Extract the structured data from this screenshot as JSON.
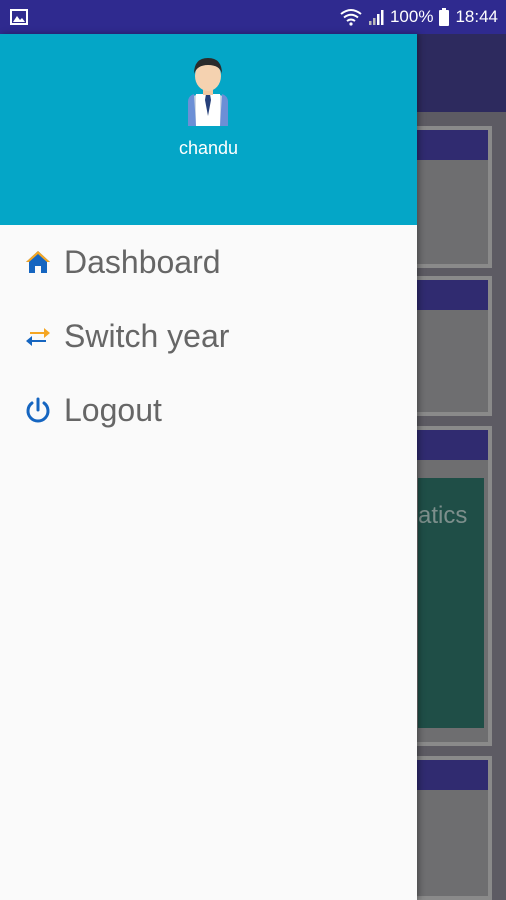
{
  "status_bar": {
    "battery": "100%",
    "time": "18:44",
    "icons": [
      "image-notification-icon",
      "wifi-icon",
      "signal-icon",
      "battery-icon"
    ]
  },
  "drawer": {
    "header": {
      "username": "chandu",
      "avatar_icon": "businessman-avatar-icon",
      "background_color": "#04a6c7"
    },
    "items": [
      {
        "label": "Dashboard",
        "icon": "home-icon"
      },
      {
        "label": "Switch year",
        "icon": "swap-arrows-icon"
      },
      {
        "label": "Logout",
        "icon": "power-icon"
      }
    ]
  },
  "background_app": {
    "partial_text": "atics"
  },
  "colors": {
    "status_bar": "#2f2a8f",
    "accent": "#1565c0",
    "switch_icon_orange": "#f5a623"
  }
}
